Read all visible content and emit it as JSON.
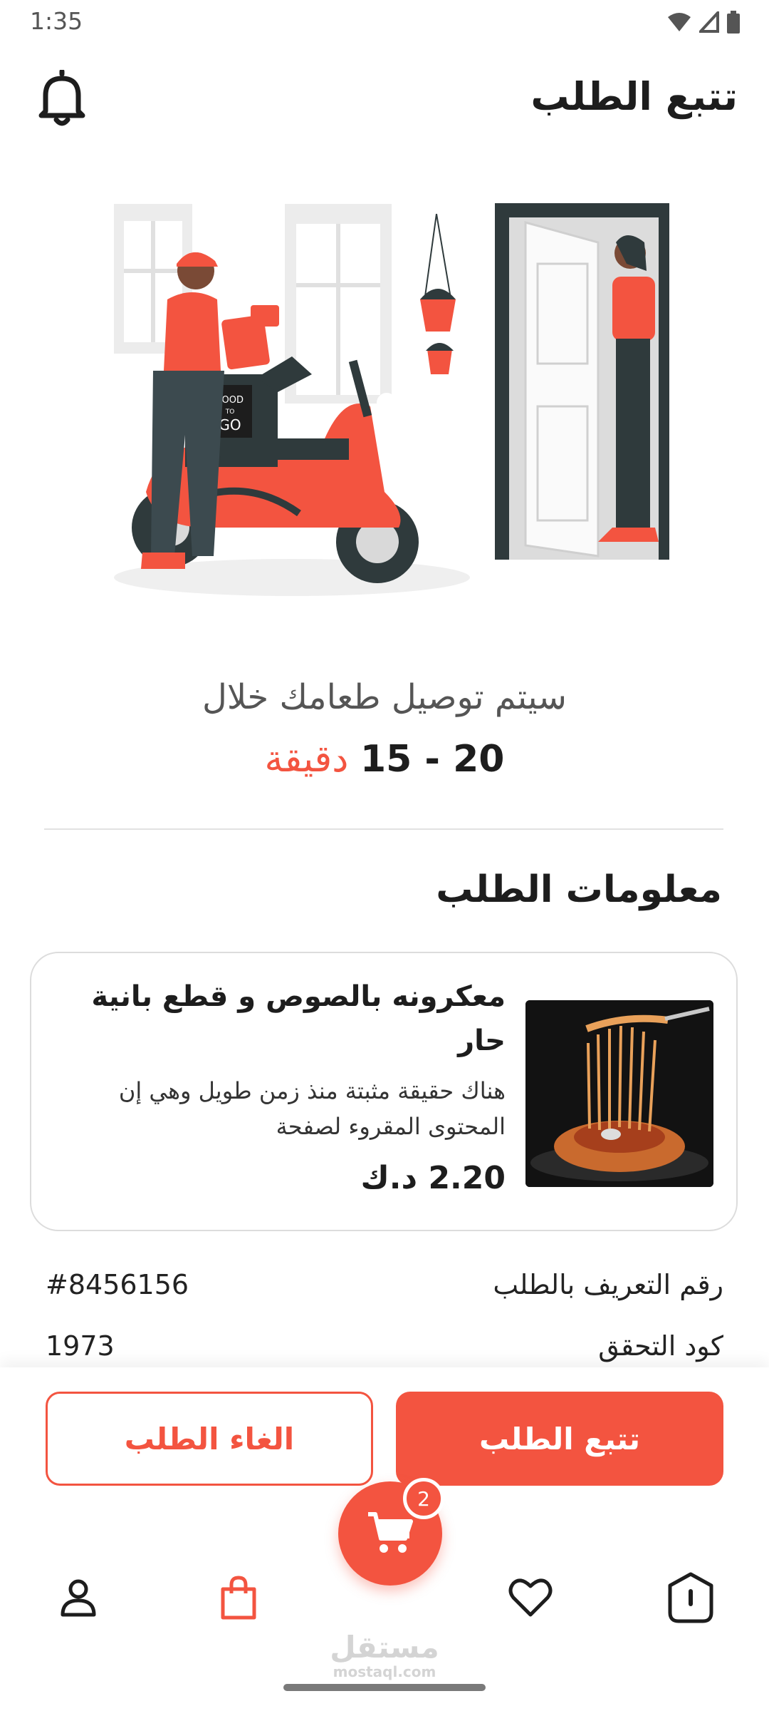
{
  "status_bar": {
    "time": "1:35"
  },
  "header": {
    "title": "تتبع الطلب"
  },
  "delivery": {
    "message": "سيتم توصيل طعامك خلال",
    "time_range": "20 - 15",
    "time_unit": "دقيقة"
  },
  "order_info": {
    "section_title": "معلومات الطلب",
    "item": {
      "name": "معكرونه بالصوص و قطع بانية حار",
      "description": "هناك حقيقة مثبتة منذ زمن طويل وهي إن المحتوى المقروء لصفحة",
      "price": "2.20 د.ك"
    },
    "rows": [
      {
        "label": "رقم التعريف بالطلب",
        "value": "#8456156"
      },
      {
        "label": "كود التحقق",
        "value": "1973"
      }
    ]
  },
  "actions": {
    "track_label": "تتبع الطلب",
    "cancel_label": "الغاء الطلب"
  },
  "cart": {
    "badge_count": "2"
  },
  "watermark": {
    "arabic": "مستقل",
    "latin": "mostaql.com"
  },
  "colors": {
    "accent": "#f35440",
    "text": "#1d1d1d"
  },
  "icons": [
    "bell-icon",
    "cart-icon",
    "profile-icon",
    "bag-icon",
    "heart-icon",
    "home-icon"
  ]
}
